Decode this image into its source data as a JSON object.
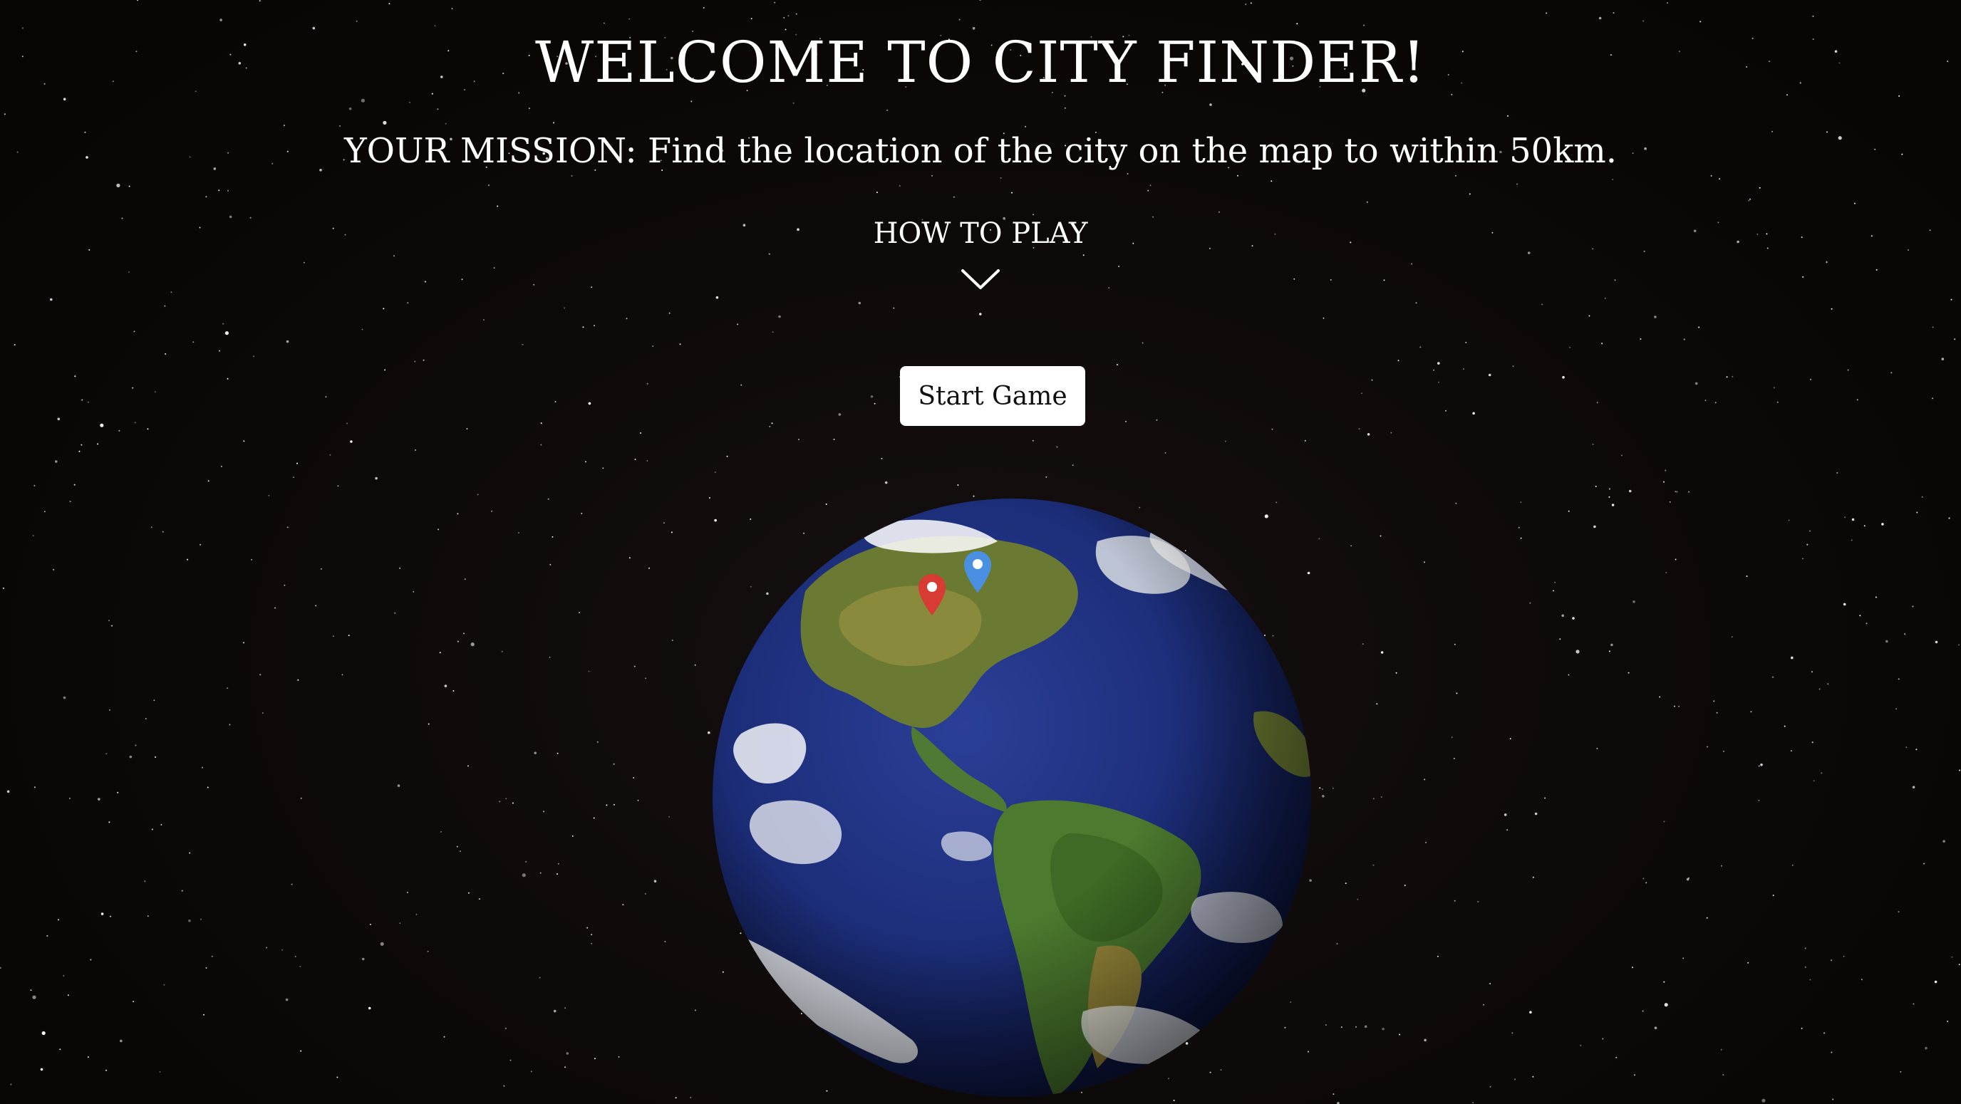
{
  "header": {
    "title": "WELCOME TO CITY FINDER!",
    "mission": "YOUR MISSION: Find the location of the city on the map to within 50km."
  },
  "how_to_play": {
    "label": "HOW TO PLAY",
    "icon": "chevron-down-icon"
  },
  "start_button": {
    "label": "Start Game"
  },
  "globe": {
    "icon": "earth-globe-image",
    "markers": [
      {
        "name": "red-map-pin-icon",
        "color": "#d83a34"
      },
      {
        "name": "blue-map-pin-icon",
        "color": "#4a90e2"
      }
    ]
  },
  "colors": {
    "background": "#0b0707",
    "text": "#ffffff",
    "button_bg": "#ffffff",
    "button_text": "#111111",
    "ocean": "#1c2d78",
    "land": "#3f6b2a"
  }
}
